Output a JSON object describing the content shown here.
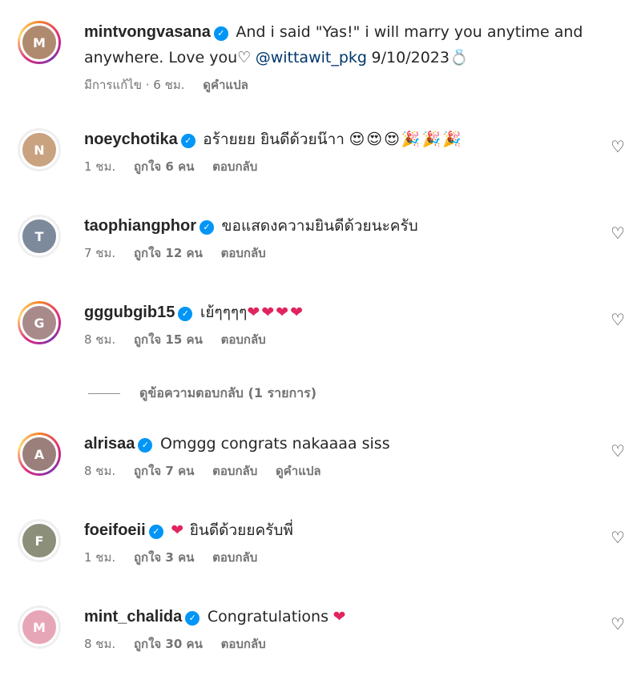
{
  "post": {
    "username": "mintvongvasana",
    "caption_part1": "And i said \"Yas!\" i will marry you anytime and",
    "caption_part2": "anywhere. Love you♡",
    "mention": "@wittawit_pkg",
    "date": "9/10/2023",
    "ring_emoji": "💍",
    "edited": "มีการแก้ไข · 6 ชม.",
    "translate": "ดูคำแปล"
  },
  "comments": [
    {
      "username": "noeychotika",
      "text": "อร้ายยย ยินดีด้วยน๊าา",
      "emoji": "😍😍😍🎉🎉🎉",
      "time": "1 ชม.",
      "likes": "ถูกใจ 6 คน",
      "reply": "ตอบกลับ"
    },
    {
      "username": "taophiangphor",
      "text": "ขอแสดงความยินดีด้วยนะครับ",
      "time": "7 ชม.",
      "likes": "ถูกใจ 12 คน",
      "reply": "ตอบกลับ"
    },
    {
      "username": "gggubgib15",
      "text": "เย้ๆๆๆๆ",
      "emoji": "❤❤❤❤",
      "time": "8 ชม.",
      "likes": "ถูกใจ 15 คน",
      "reply": "ตอบกลับ"
    },
    {
      "username": "alrisaa",
      "text": "Omggg congrats nakaaaa siss",
      "time": "8 ชม.",
      "likes": "ถูกใจ 7 คน",
      "reply": "ตอบกลับ",
      "translate": "ดูคำแปล"
    },
    {
      "username": "foeifoeii",
      "emoji": "❤",
      "text": "ยินดีด้วยยครับพี่",
      "time": "1 ชม.",
      "likes": "ถูกใจ 3 คน",
      "reply": "ตอบกลับ"
    },
    {
      "username": "mint_chalida",
      "text": "Congratulations",
      "emoji": "❤",
      "time": "8 ชม.",
      "likes": "ถูกใจ 30 คน",
      "reply": "ตอบกลับ"
    }
  ],
  "view_replies": "ดูข้อความตอบกลับ (1 รายการ)",
  "icons": {
    "verified": "verified-badge-icon",
    "like": "heart-outline-icon"
  },
  "colors": {
    "verified": "#0095f6",
    "mention": "#00376b",
    "meta": "#737373",
    "heart": "#e0245e"
  }
}
